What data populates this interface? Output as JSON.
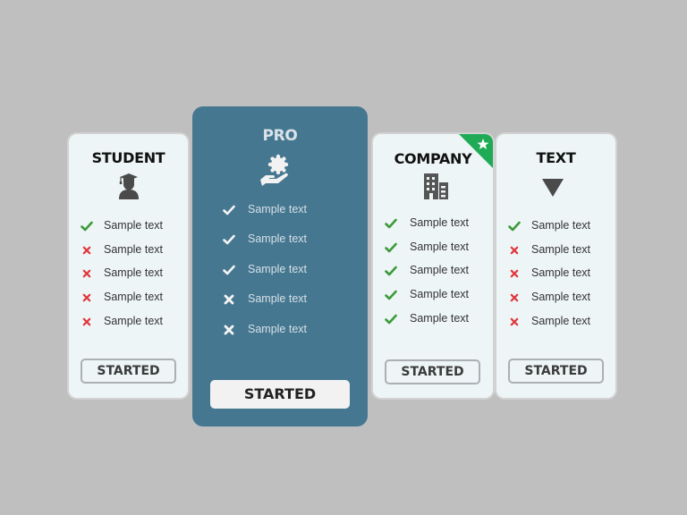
{
  "colors": {
    "background": "#bfbfbf",
    "card": "#eef5f6",
    "pro_card": "#467791",
    "check": "#3c9a3a",
    "cross": "#e0393e",
    "ribbon": "#1faa55"
  },
  "plans": [
    {
      "id": "student",
      "title": "STUDENT",
      "icon": "graduate-icon",
      "features": [
        {
          "text": "Sample text",
          "included": true
        },
        {
          "text": "Sample text",
          "included": false
        },
        {
          "text": "Sample text",
          "included": false
        },
        {
          "text": "Sample text",
          "included": false
        },
        {
          "text": "Sample text",
          "included": false
        }
      ],
      "button": "STARTED"
    },
    {
      "id": "pro",
      "title": "PRO",
      "icon": "hand-gear-icon",
      "features": [
        {
          "text": "Sample text",
          "included": true
        },
        {
          "text": "Sample text",
          "included": true
        },
        {
          "text": "Sample text",
          "included": true
        },
        {
          "text": "Sample text",
          "included": false
        },
        {
          "text": "Sample text",
          "included": false
        }
      ],
      "button": "STARTED"
    },
    {
      "id": "company",
      "title": "COMPANY",
      "icon": "building-icon",
      "badge": "star-icon",
      "features": [
        {
          "text": "Sample text",
          "included": true
        },
        {
          "text": "Sample text",
          "included": true
        },
        {
          "text": "Sample text",
          "included": true
        },
        {
          "text": "Sample text",
          "included": true
        },
        {
          "text": "Sample text",
          "included": true
        }
      ],
      "button": "STARTED"
    },
    {
      "id": "text",
      "title": "TEXT",
      "icon": "triangle-down-icon",
      "features": [
        {
          "text": "Sample text",
          "included": true
        },
        {
          "text": "Sample text",
          "included": false
        },
        {
          "text": "Sample text",
          "included": false
        },
        {
          "text": "Sample text",
          "included": false
        },
        {
          "text": "Sample text",
          "included": false
        }
      ],
      "button": "STARTED"
    }
  ]
}
